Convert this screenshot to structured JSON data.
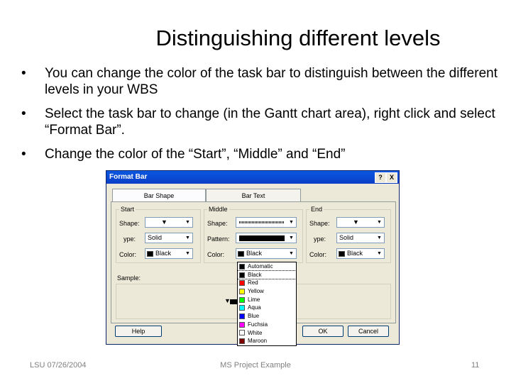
{
  "slide": {
    "title": "Distinguishing different levels",
    "bullets": [
      "You can change the color of the task bar to distinguish between the different levels in your WBS",
      "Select the task bar to change (in the Gantt chart area), right click and select “Format Bar”.",
      "Change the color of the “Start”, “Middle” and “End”"
    ],
    "bullet_glyph": "•",
    "footer_left": "LSU 07/26/2004",
    "footer_center": "MS Project Example",
    "page_number": "11"
  },
  "dialog": {
    "title": "Format Bar",
    "help_btn": "?",
    "close_btn": "X",
    "tabs": [
      "Bar Shape",
      "Bar Text"
    ],
    "start": {
      "group_label": "Start",
      "shape_label": "Shape:",
      "type_label": "ype:",
      "color_label": "Color:",
      "type_value": "Solid",
      "color_value": "Black"
    },
    "middle": {
      "group_label": "Middle",
      "shape_label": "Shape:",
      "pattern_label": "Pattern:",
      "color_label": "Color:",
      "color_value": "Black"
    },
    "end": {
      "group_label": "End",
      "shape_label": "Shape:",
      "type_label": "ype:",
      "color_label": "Color:",
      "type_value": "Solid",
      "color_value": "Black"
    },
    "sample_label": "Sample:",
    "help_button": "Help",
    "ok_button": "OK",
    "cancel_button": "Cancel",
    "color_options": [
      {
        "label": "Automatic",
        "color": "#000000"
      },
      {
        "label": "Black",
        "color": "#000000"
      },
      {
        "label": "Red",
        "color": "#ff0000"
      },
      {
        "label": "Yellow",
        "color": "#ffff00"
      },
      {
        "label": "Lime",
        "color": "#00ff00"
      },
      {
        "label": "Aqua",
        "color": "#00ffff"
      },
      {
        "label": "Blue",
        "color": "#0000ff"
      },
      {
        "label": "Fuchsia",
        "color": "#ff00ff"
      },
      {
        "label": "White",
        "color": "#ffffff"
      },
      {
        "label": "Maroon",
        "color": "#800000"
      }
    ],
    "selected_option": "Black"
  }
}
